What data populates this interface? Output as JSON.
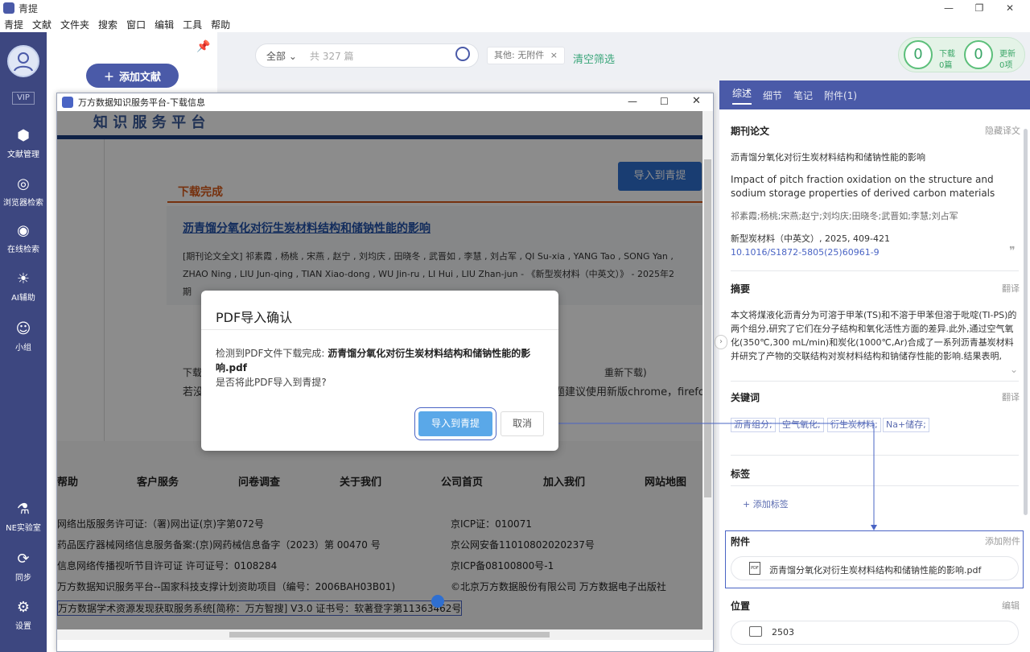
{
  "app": {
    "title": "青提"
  },
  "menu": [
    "青提",
    "文献",
    "文件夹",
    "搜索",
    "窗口",
    "编辑",
    "工具",
    "帮助"
  ],
  "sidebar": {
    "vip": "VIP",
    "items": [
      {
        "label": "文献管理",
        "icon": "box-icon"
      },
      {
        "label": "浏览器检索",
        "icon": "dribbble-icon"
      },
      {
        "label": "在线检索",
        "icon": "eye-icon"
      },
      {
        "label": "AI辅助",
        "icon": "bulb-icon"
      },
      {
        "label": "小组",
        "icon": "group-icon"
      },
      {
        "label": "NE实验室",
        "icon": "microscope-icon"
      },
      {
        "label": "同步",
        "icon": "sync-icon"
      },
      {
        "label": "设置",
        "icon": "gear-icon"
      }
    ]
  },
  "library": {
    "add_label": "添加文献"
  },
  "toolbar": {
    "filter": "全部",
    "placeholder": "共 327 篇",
    "tag": "其他: 无附件",
    "tag_close": "×",
    "clear": "清空筛选",
    "download": {
      "count": "0",
      "label": "下载",
      "sub": "0篇"
    },
    "update": {
      "count": "0",
      "label": "更新",
      "sub": "0项"
    }
  },
  "right": {
    "tabs": [
      "综述",
      "细节",
      "笔记",
      "附件(1)"
    ],
    "journal_type": "期刊论文",
    "hide_translation": "隐藏译文",
    "title_cn": "沥青馏分氧化对衍生炭材料结构和储钠性能的影响",
    "title_en": "Impact of pitch fraction oxidation on the structure and sodium storage properties of derived carbon materials",
    "authors": "祁素霞;杨桃;宋燕;赵宁;刘均庆;田晓冬;武晋如;李慧;刘占军",
    "journal": "新型炭材料（中英文）, 2025, 409-421",
    "doi": "10.1016/S1872-5805(25)60961-9",
    "abstract_h": "摘要",
    "translate": "翻译",
    "abstract": "本文将煤液化沥青分为可溶于甲苯(TS)和不溶于甲苯但溶于吡啶(TI-PS)的两个组分,研究了它们在分子结构和氧化活性方面的差异.此外,通过空气氧化(350℃,300 mL/min)和炭化(1000℃,Ar)合成了一系列沥青基炭材料并研究了产物的交联结构对炭材料结构和钠储存性能的影响.结果表明,在...",
    "keywords_h": "关键词",
    "keywords": [
      "沥青组分;",
      "空气氧化;",
      "衍生炭材料;",
      "Na+储存;"
    ],
    "tags_h": "标签",
    "add_tag": "+ 添加标签",
    "attach_h": "附件",
    "add_attach": "添加附件",
    "attach_file": "沥青馏分氧化对衍生炭材料结构和储钠性能的影响.pdf",
    "location_h": "位置",
    "edit": "编辑",
    "folder": "2503"
  },
  "browser": {
    "title": "万方数据知识服务平台-下载信息",
    "header": "知 识 服 务 平 台",
    "import_btn": "导入到青提",
    "tab": "下载完成",
    "paper_title": "沥青馏分氧化对衍生炭材料结构和储钠性能的影响",
    "meta1": "[期刊论文全文] 祁素霞 , 杨桃 , 宋燕 , 赵宁 , 刘均庆 , 田晓冬 , 武晋如 , 李慧 , 刘占军 , QI Su-xia , YANG Tao , SONG Yan ,",
    "meta2": "ZHAO Ning , LIU Jun-qing , TIAN Xiao-dong , WU Jin-ru , LI Hui , LIU Zhan-jun - 《新型炭材料（中英文）》 - 2025年2",
    "meta3": "期",
    "tip1": "下载",
    "tip1b": "重新下载)",
    "tip2": "若没",
    "tip2b": "问题建议使用新版chrome，firefo",
    "footer_nav": [
      "帮助",
      "客户服务",
      "问卷调查",
      "关于我们",
      "公司首页",
      "加入我们",
      "网站地图"
    ],
    "footer_left": [
      "网络出版服务许可证:（署)网出证(京)字第072号",
      "药品医疗器械网络信息服务备案:(京)网药械信息备字（2023）第 00470 号",
      "信息网络传播视听节目许可证 许可证号：0108284",
      "万方数据知识服务平台--国家科技支撑计划资助项目（编号：2006BAH03B01)",
      "万方数据学术资源发现获取服务系统[简称：万方智搜] V3.0 证书号：软著登字第11363462号"
    ],
    "footer_right": [
      "京ICP证：010071",
      "京公网安备11010802020237号",
      "京ICP备08100800号-1",
      "©北京万方数据股份有限公司 万方数据电子出版社"
    ]
  },
  "dialog": {
    "title": "PDF导入确认",
    "msg_prefix": "检测到PDF文件下载完成: ",
    "filename": "沥青馏分氧化对衍生炭材料结构和储钠性能的影响.pdf",
    "question": "是否将此PDF导入到青提?",
    "ok": "导入到青提",
    "cancel": "取消"
  }
}
